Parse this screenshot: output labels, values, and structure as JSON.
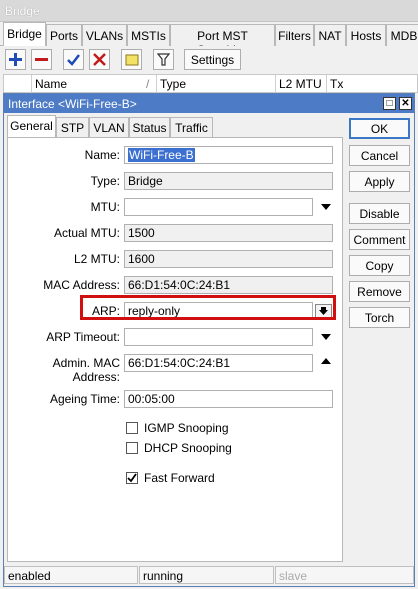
{
  "bridge_window": {
    "title": "Bridge",
    "tabs": [
      "Bridge",
      "Ports",
      "VLANs",
      "MSTIs",
      "Port MST Overrides",
      "Filters",
      "NAT",
      "Hosts",
      "MDB"
    ],
    "toolbar": {
      "settings_label": "Settings"
    },
    "columns": [
      "Name",
      "Type",
      "L2 MTU",
      "Tx"
    ]
  },
  "dialog": {
    "title": "Interface <WiFi-Free-B>",
    "tabs": [
      "General",
      "STP",
      "VLAN",
      "Status",
      "Traffic"
    ],
    "fields": {
      "name_label": "Name:",
      "name_value": "WiFi-Free-B",
      "type_label": "Type:",
      "type_value": "Bridge",
      "mtu_label": "MTU:",
      "mtu_value": "",
      "actual_mtu_label": "Actual MTU:",
      "actual_mtu_value": "1500",
      "l2_mtu_label": "L2 MTU:",
      "l2_mtu_value": "1600",
      "mac_label": "MAC Address:",
      "mac_value": "66:D1:54:0C:24:B1",
      "arp_label": "ARP:",
      "arp_value": "reply-only",
      "arp_timeout_label": "ARP Timeout:",
      "arp_timeout_value": "",
      "admin_mac_label": "Admin. MAC Address:",
      "admin_mac_value": "66:D1:54:0C:24:B1",
      "ageing_label": "Ageing Time:",
      "ageing_value": "00:05:00"
    },
    "checkboxes": {
      "igmp_label": "IGMP Snooping",
      "igmp_checked": false,
      "dhcp_label": "DHCP Snooping",
      "dhcp_checked": false,
      "fast_forward_label": "Fast Forward",
      "fast_forward_checked": true
    },
    "buttons": [
      "OK",
      "Cancel",
      "Apply",
      "Disable",
      "Comment",
      "Copy",
      "Remove",
      "Torch"
    ],
    "status": {
      "state": "enabled",
      "running": "running",
      "slave": "slave"
    }
  },
  "colors": {
    "title_bar": "#4d7bc6",
    "highlight": "#d01010",
    "selection": "#3b6fd0"
  }
}
